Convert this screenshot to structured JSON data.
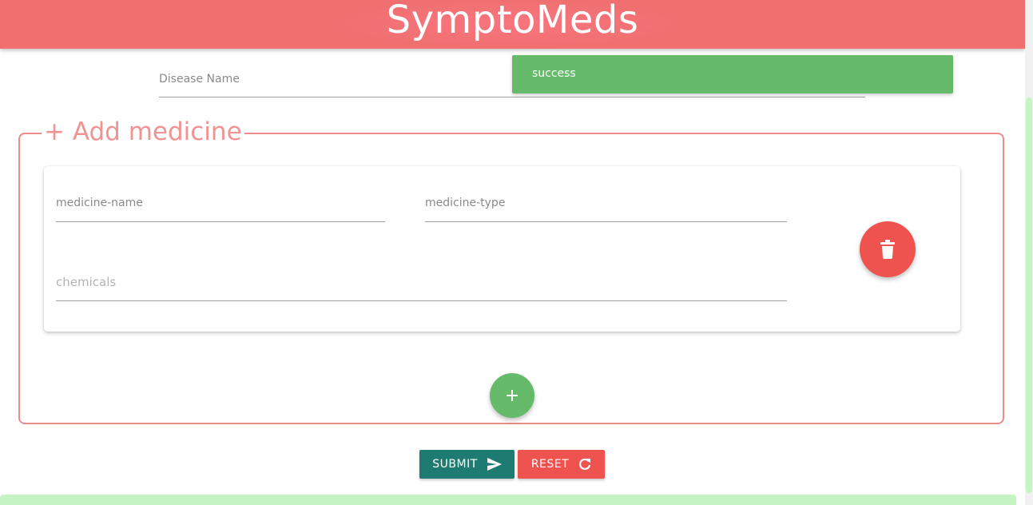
{
  "header": {
    "title": "SymptoMeds"
  },
  "form": {
    "disease_name": {
      "label": "Disease Name",
      "value": ""
    }
  },
  "toast": {
    "message": "success"
  },
  "medicine_section": {
    "legend": "+ Add medicine",
    "medicines": [
      {
        "name": {
          "label": "medicine-name",
          "value": ""
        },
        "type": {
          "label": "medicine-type",
          "value": ""
        },
        "chemicals": {
          "placeholder": "chemicals",
          "value": ""
        }
      }
    ]
  },
  "actions": {
    "submit_label": "SUBMIT",
    "reset_label": "RESET"
  },
  "icons": {
    "delete": "trash-icon",
    "add": "plus-icon",
    "submit": "send-icon",
    "reset": "refresh-icon"
  },
  "colors": {
    "header": "#f07070",
    "accent_pink": "#ec8b8b",
    "success": "#66bb6a",
    "danger": "#ef5350",
    "primary": "#1e7b71"
  }
}
